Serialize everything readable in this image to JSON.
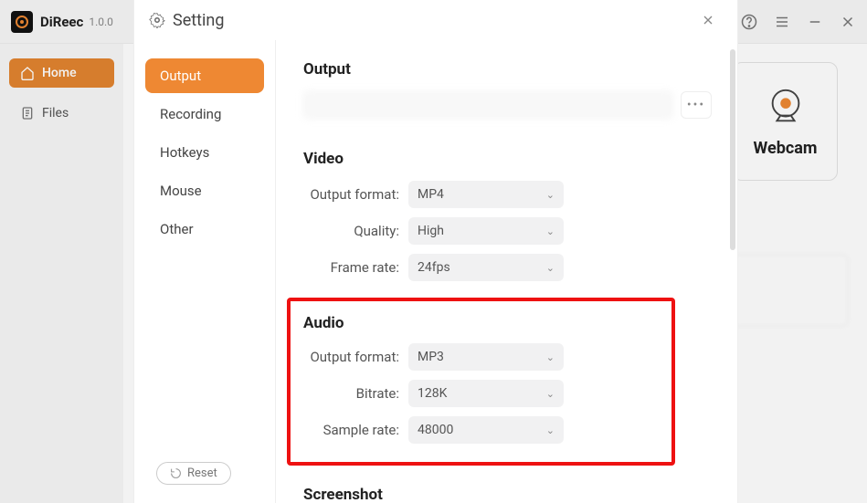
{
  "app": {
    "name": "DiReec",
    "version": "1.0.0"
  },
  "sidebar": {
    "home_label": "Home",
    "files_label": "Files"
  },
  "webcam_card": {
    "label": "Webcam"
  },
  "modal": {
    "title": "Setting",
    "nav": {
      "output": "Output",
      "recording": "Recording",
      "hotkeys": "Hotkeys",
      "mouse": "Mouse",
      "other": "Other"
    },
    "reset_label": "Reset",
    "sections": {
      "output_title": "Output",
      "video": {
        "title": "Video",
        "format_label": "Output format:",
        "format_value": "MP4",
        "quality_label": "Quality:",
        "quality_value": "High",
        "framerate_label": "Frame rate:",
        "framerate_value": "24fps"
      },
      "audio": {
        "title": "Audio",
        "format_label": "Output format:",
        "format_value": "MP3",
        "bitrate_label": "Bitrate:",
        "bitrate_value": "128K",
        "samplerate_label": "Sample rate:",
        "samplerate_value": "48000"
      },
      "screenshot_title": "Screenshot"
    }
  },
  "colors": {
    "accent": "#ee8833",
    "highlight_border": "#e11"
  }
}
